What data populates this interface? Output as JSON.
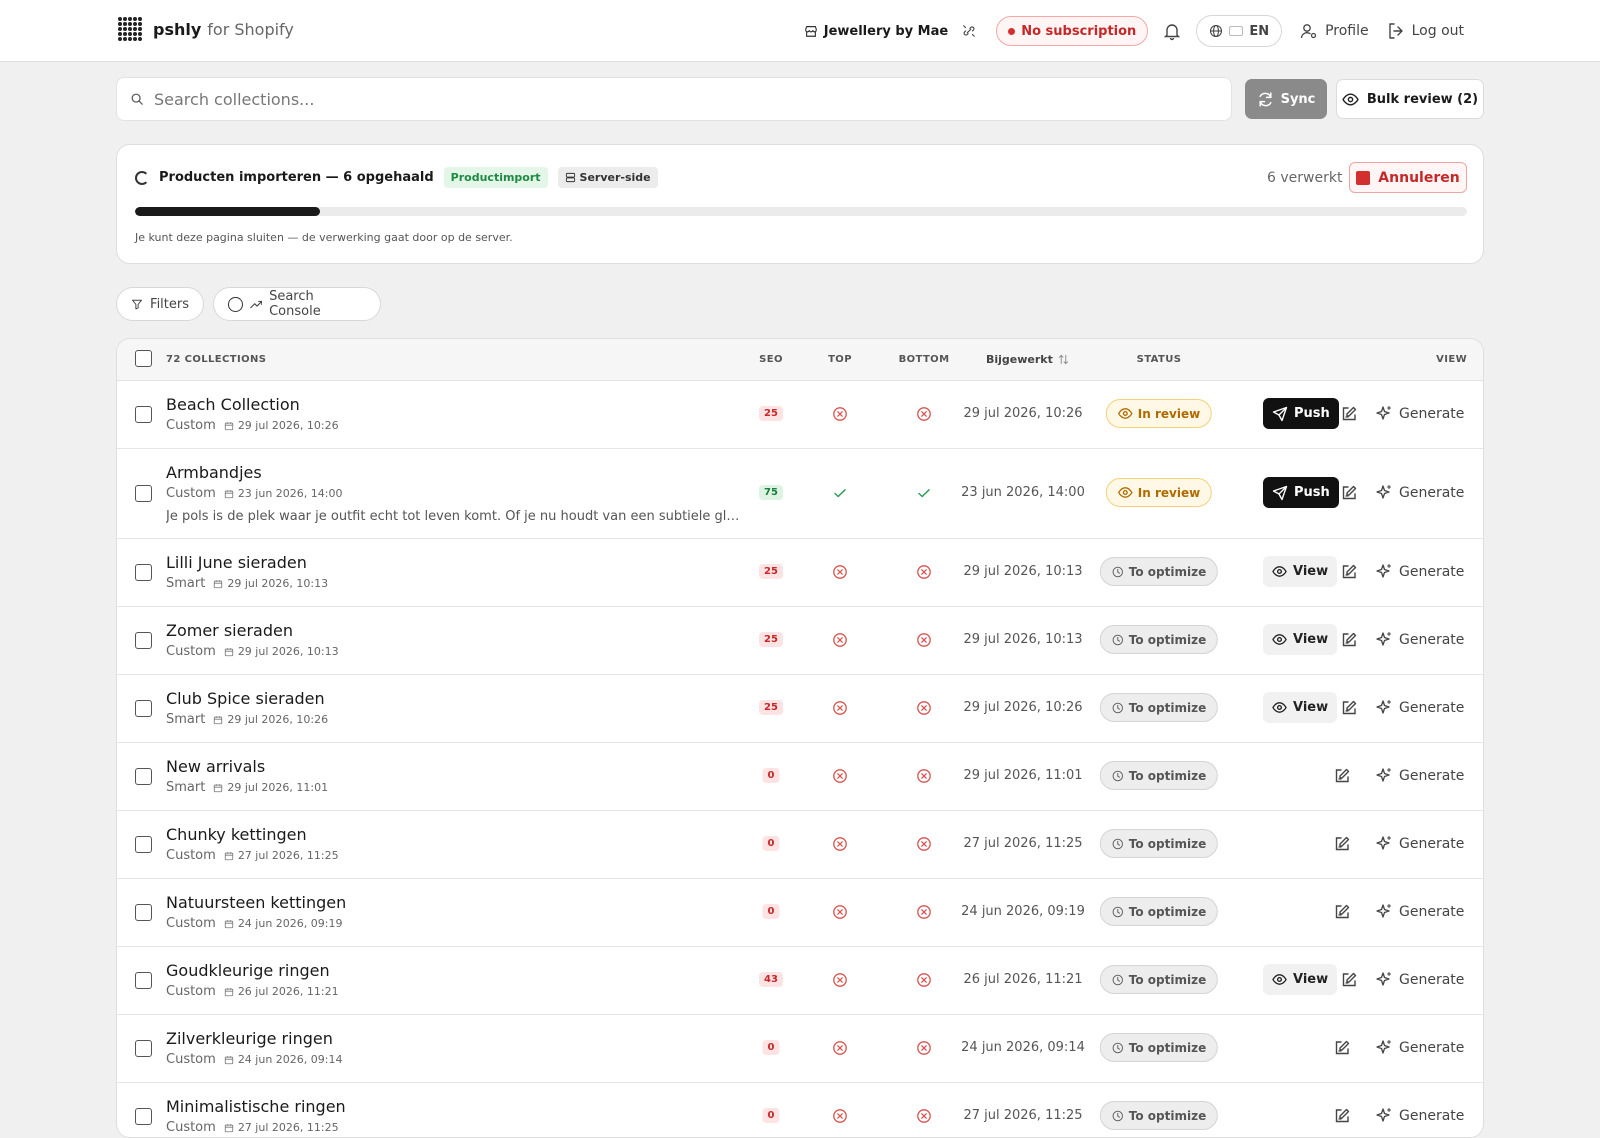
{
  "header": {
    "brand": "pshly",
    "brand_suffix": "for Shopify",
    "store": "Jewellery by Mae",
    "subscription": "No subscription",
    "language": "EN",
    "profile": "Profile",
    "logout": "Log out"
  },
  "search": {
    "placeholder": "Search collections..."
  },
  "actions": {
    "sync": "Sync",
    "bulk_review": "Bulk review (2)"
  },
  "import": {
    "title": "Producten importeren — 6 opgehaald",
    "tag_primary": "Productimport",
    "tag_secondary": "Server-side",
    "processed": "6 verwerkt",
    "cancel": "Annuleren",
    "progress": 0.139,
    "note": "Je kunt deze pagina sluiten — de verwerking gaat door op de server."
  },
  "filters": {
    "filters_label": "Filters",
    "console_label": "Search Console"
  },
  "table": {
    "headers": {
      "count": "72 COLLECTIONS",
      "seo": "SEO",
      "top": "TOP",
      "bottom": "BOTTOM",
      "updated": "Bijgewerkt",
      "status": "STATUS",
      "view": "VIEW"
    },
    "rows": [
      {
        "title": "Beach Collection",
        "type": "Custom",
        "date": "29 jul 2026, 10:26",
        "desc": "",
        "seo": "25",
        "seo_level": "red",
        "top": false,
        "bottom": false,
        "updated": "29 jul 2026, 10:26",
        "status": "In review",
        "status_kind": "review",
        "action": "Push",
        "generate": "Generate"
      },
      {
        "title": "Armbandjes",
        "type": "Custom",
        "date": "23 jun 2026, 14:00",
        "desc": "Je pols is de plek waar je outfit echt tot leven komt. Of je nu houdt van een subtiele glans of van een statement",
        "seo": "75",
        "seo_level": "green",
        "top": true,
        "bottom": true,
        "updated": "23 jun 2026, 14:00",
        "status": "In review",
        "status_kind": "review",
        "action": "Push",
        "generate": "Generate"
      },
      {
        "title": "Lilli June sieraden",
        "type": "Smart",
        "date": "29 jul 2026, 10:13",
        "desc": "",
        "seo": "25",
        "seo_level": "red",
        "top": false,
        "bottom": false,
        "updated": "29 jul 2026, 10:13",
        "status": "To optimize",
        "status_kind": "opt",
        "action": "View",
        "generate": "Generate"
      },
      {
        "title": "Zomer sieraden",
        "type": "Custom",
        "date": "29 jul 2026, 10:13",
        "desc": "",
        "seo": "25",
        "seo_level": "red",
        "top": false,
        "bottom": false,
        "updated": "29 jul 2026, 10:13",
        "status": "To optimize",
        "status_kind": "opt",
        "action": "View",
        "generate": "Generate"
      },
      {
        "title": "Club Spice sieraden",
        "type": "Smart",
        "date": "29 jul 2026, 10:26",
        "desc": "",
        "seo": "25",
        "seo_level": "red",
        "top": false,
        "bottom": false,
        "updated": "29 jul 2026, 10:26",
        "status": "To optimize",
        "status_kind": "opt",
        "action": "View",
        "generate": "Generate"
      },
      {
        "title": "New arrivals",
        "type": "Smart",
        "date": "29 jul 2026, 11:01",
        "desc": "",
        "seo": "0",
        "seo_level": "red",
        "top": false,
        "bottom": false,
        "updated": "29 jul 2026, 11:01",
        "status": "To optimize",
        "status_kind": "opt",
        "action": "",
        "generate": "Generate"
      },
      {
        "title": "Chunky kettingen",
        "type": "Custom",
        "date": "27 jul 2026, 11:25",
        "desc": "",
        "seo": "0",
        "seo_level": "red",
        "top": false,
        "bottom": false,
        "updated": "27 jul 2026, 11:25",
        "status": "To optimize",
        "status_kind": "opt",
        "action": "",
        "generate": "Generate"
      },
      {
        "title": "Natuursteen kettingen",
        "type": "Custom",
        "date": "24 jun 2026, 09:19",
        "desc": "",
        "seo": "0",
        "seo_level": "red",
        "top": false,
        "bottom": false,
        "updated": "24 jun 2026, 09:19",
        "status": "To optimize",
        "status_kind": "opt",
        "action": "",
        "generate": "Generate"
      },
      {
        "title": "Goudkleurige ringen",
        "type": "Custom",
        "date": "26 jul 2026, 11:21",
        "desc": "",
        "seo": "43",
        "seo_level": "red",
        "top": false,
        "bottom": false,
        "updated": "26 jul 2026, 11:21",
        "status": "To optimize",
        "status_kind": "opt",
        "action": "View",
        "generate": "Generate"
      },
      {
        "title": "Zilverkleurige ringen",
        "type": "Custom",
        "date": "24 jun 2026, 09:14",
        "desc": "",
        "seo": "0",
        "seo_level": "red",
        "top": false,
        "bottom": false,
        "updated": "24 jun 2026, 09:14",
        "status": "To optimize",
        "status_kind": "opt",
        "action": "",
        "generate": "Generate"
      },
      {
        "title": "Minimalistische ringen",
        "type": "Custom",
        "date": "27 jul 2026, 11:25",
        "desc": "",
        "seo": "0",
        "seo_level": "red",
        "top": false,
        "bottom": false,
        "updated": "27 jul 2026, 11:25",
        "status": "To optimize",
        "status_kind": "opt",
        "action": "",
        "generate": "Generate"
      }
    ]
  }
}
